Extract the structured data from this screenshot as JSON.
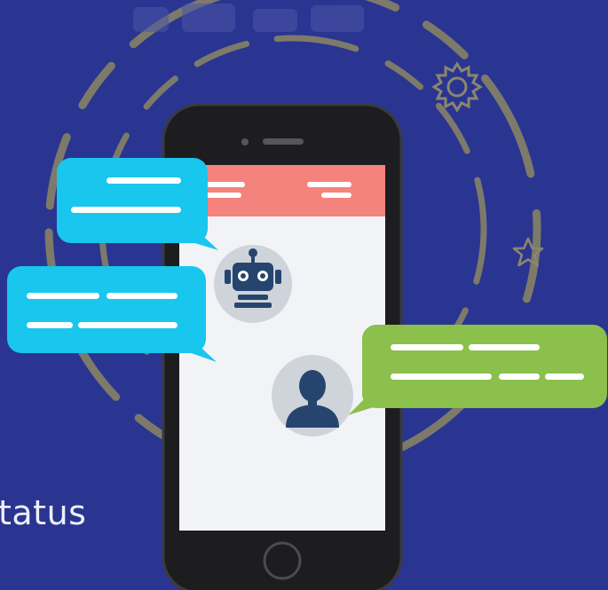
{
  "illustration": {
    "partial_caption": "tatus",
    "icons": [
      "robot-avatar-icon",
      "person-avatar-icon",
      "gear-icon",
      "star-icon"
    ],
    "colors": {
      "background": "#2a3591",
      "phone_body": "#1d1d1f",
      "screen": "#f2f3f7",
      "header_bar": "#f4837d",
      "bubble_blue": "#18c6ee",
      "bubble_green": "#8bc04c",
      "ring": "#7d7a6a",
      "avatar_bg": "#cfd4da",
      "avatar_fg": "#26456e"
    }
  }
}
